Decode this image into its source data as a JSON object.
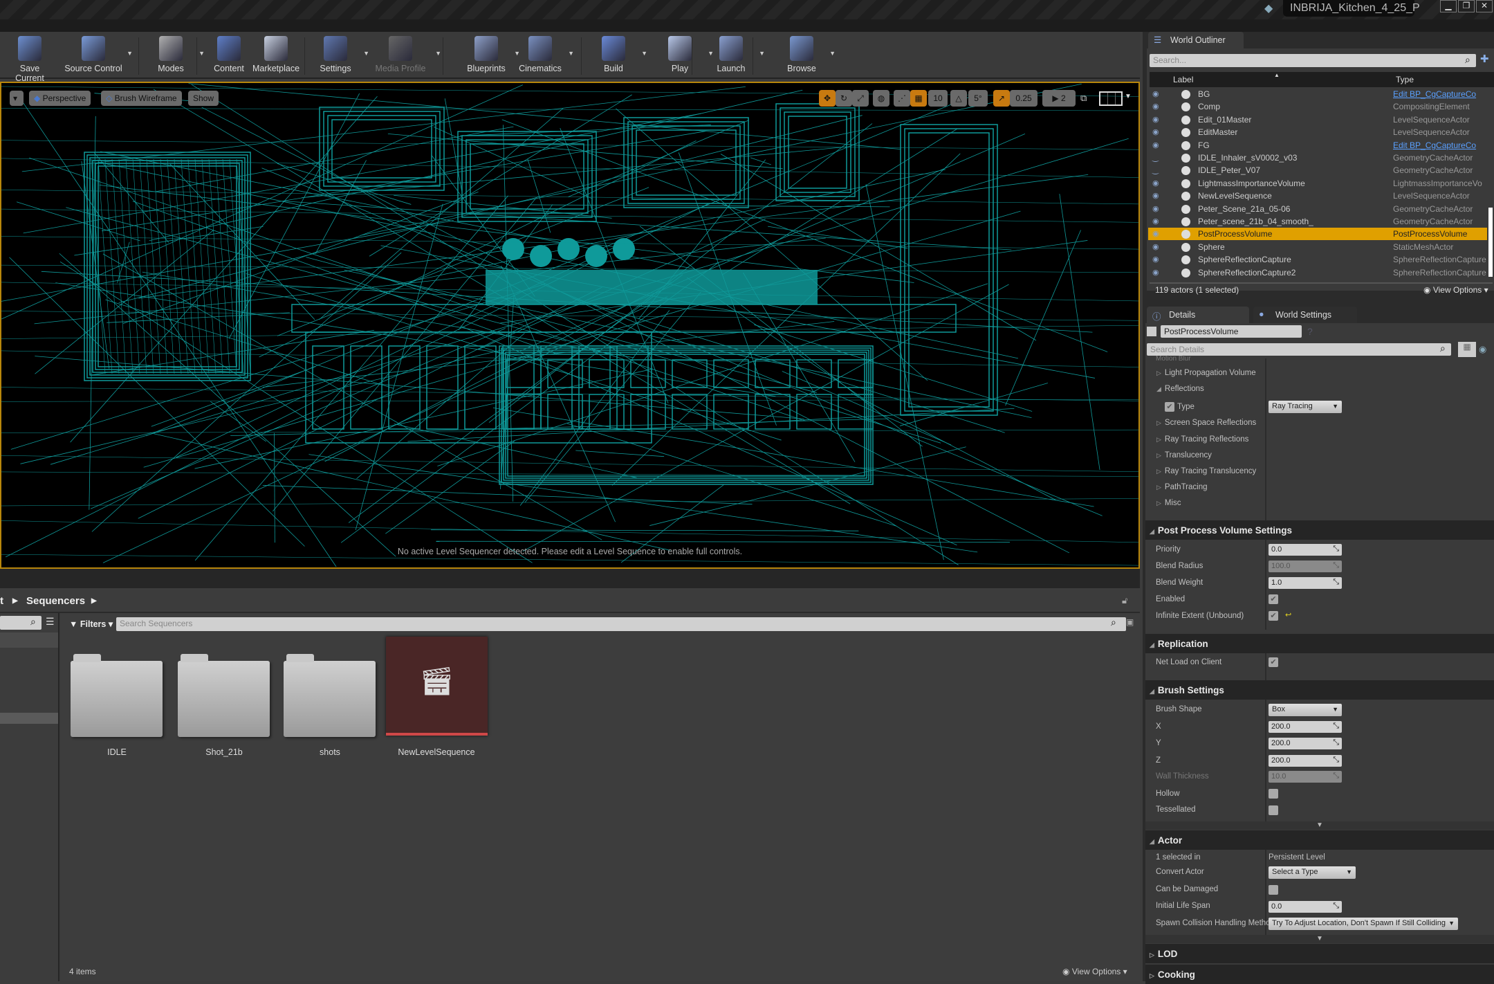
{
  "window": {
    "tab_title": "INBRIJA_Kitchen_4_25_P",
    "minimize": "▁",
    "maximize": "❐",
    "close": "✕"
  },
  "toolbar": {
    "items": [
      {
        "label": "Save Current",
        "icon": "save-icon",
        "color": "#6d8fd0"
      },
      {
        "label": "Source Control",
        "icon": "source-control-icon",
        "color": "#7a9bd8"
      },
      {
        "label": "Modes",
        "icon": "modes-icon",
        "color": "#b0b0b0"
      },
      {
        "label": "Content",
        "icon": "content-icon",
        "color": "#5f7fc8"
      },
      {
        "label": "Marketplace",
        "icon": "marketplace-icon",
        "color": "#c8d0e0"
      },
      {
        "label": "Settings",
        "icon": "settings-icon",
        "color": "#6078b0"
      },
      {
        "label": "Media Profile",
        "icon": "media-profile-icon",
        "color": "#666",
        "disabled": true
      },
      {
        "label": "Blueprints",
        "icon": "blueprints-icon",
        "color": "#8ea0c8"
      },
      {
        "label": "Cinematics",
        "icon": "cinematics-icon",
        "color": "#7a90c0"
      },
      {
        "label": "Build",
        "icon": "build-icon",
        "color": "#6a8ad8"
      },
      {
        "label": "Play",
        "icon": "play-icon",
        "color": "#b8c8e8"
      },
      {
        "label": "Launch",
        "icon": "launch-icon",
        "color": "#8aa0d0"
      },
      {
        "label": "Browse",
        "icon": "browse-icon",
        "color": "#7a98d0"
      }
    ]
  },
  "viewport": {
    "view_mode_button": "Perspective",
    "render_mode_button": "Brush Wireframe",
    "show_button": "Show",
    "grid_snap": "10",
    "rotation_snap": "5°",
    "scale_snap": "0.25",
    "camera_speed": "2",
    "message": "No active Level Sequencer detected. Please edit a Level Sequence to enable full controls.",
    "wire_color": "#0f9a9a"
  },
  "content_browser": {
    "breadcrumb": [
      "t",
      "Sequencers"
    ],
    "filters_label": "Filters",
    "search_placeholder": "Search Sequencers",
    "items": [
      {
        "name": "IDLE",
        "kind": "folder"
      },
      {
        "name": "Shot_21b",
        "kind": "folder"
      },
      {
        "name": "shots",
        "kind": "folder"
      },
      {
        "name": "NewLevelSequence",
        "kind": "level-sequence",
        "color": "#4a2626",
        "bar_color": "#d04848"
      }
    ],
    "item_count": "4 items",
    "view_options": "View Options"
  },
  "outliner": {
    "tab": "World Outliner",
    "search_placeholder": "Search...",
    "col_label": "Label",
    "col_type": "Type",
    "rows": [
      {
        "label": "BG",
        "type": "Edit BP_CgCaptureCo",
        "link": true,
        "visible": true
      },
      {
        "label": "Comp",
        "type": "CompositingElement",
        "visible": true
      },
      {
        "label": "Edit_01Master",
        "type": "LevelSequenceActor",
        "visible": true
      },
      {
        "label": "EditMaster",
        "type": "LevelSequenceActor",
        "visible": true
      },
      {
        "label": "FG",
        "type": "Edit BP_CgCaptureCo",
        "link": true,
        "visible": true
      },
      {
        "label": "IDLE_Inhaler_sV0002_v03",
        "type": "GeometryCacheActor",
        "visible": false
      },
      {
        "label": "IDLE_Peter_V07",
        "type": "GeometryCacheActor",
        "visible": false
      },
      {
        "label": "LightmassImportanceVolume",
        "type": "LightmassImportanceVo",
        "visible": true
      },
      {
        "label": "NewLevelSequence",
        "type": "LevelSequenceActor",
        "visible": true
      },
      {
        "label": "Peter_Scene_21a_05-06",
        "type": "GeometryCacheActor",
        "visible": true
      },
      {
        "label": "Peter_scene_21b_04_smooth_",
        "type": "GeometryCacheActor",
        "visible": true
      },
      {
        "label": "PostProcessVolume",
        "type": "PostProcessVolume",
        "visible": true,
        "selected": true
      },
      {
        "label": "Sphere",
        "type": "StaticMeshActor",
        "visible": true
      },
      {
        "label": "SphereReflectionCapture",
        "type": "SphereReflectionCapture",
        "visible": true
      },
      {
        "label": "SphereReflectionCapture2",
        "type": "SphereReflectionCapture",
        "visible": true
      }
    ],
    "status": "119 actors (1 selected)",
    "view_options": "View Options",
    "selection_color": "#e0a000"
  },
  "details": {
    "tab": "Details",
    "world_settings_tab": "World Settings",
    "actor_name": "PostProcessVolume",
    "search_placeholder": "Search Details",
    "cut_row": "Motion Blur",
    "categories": [
      "Light Propagation Volume",
      "Reflections",
      "Screen Space Reflections",
      "Ray Tracing Reflections",
      "Translucency",
      "Ray Tracing Translucency",
      "PathTracing",
      "Misc"
    ],
    "reflections_type_label": "Type",
    "reflections_type_value": "Ray Tracing",
    "ppv": {
      "title": "Post Process Volume Settings",
      "priority_label": "Priority",
      "priority": "0.0",
      "blend_radius_label": "Blend Radius",
      "blend_radius": "100.0",
      "blend_weight_label": "Blend Weight",
      "blend_weight": "1.0",
      "enabled_label": "Enabled",
      "enabled": true,
      "infinite_label": "Infinite Extent (Unbound)",
      "infinite": true
    },
    "replication": {
      "title": "Replication",
      "net_load_label": "Net Load on Client",
      "net_load": true
    },
    "brush": {
      "title": "Brush Settings",
      "shape_label": "Brush Shape",
      "shape": "Box",
      "x_label": "X",
      "x": "200.0",
      "y_label": "Y",
      "y": "200.0",
      "z_label": "Z",
      "z": "200.0",
      "wall_label": "Wall Thickness",
      "wall": "10.0",
      "hollow_label": "Hollow",
      "hollow": false,
      "tess_label": "Tessellated",
      "tess": false
    },
    "actor": {
      "title": "Actor",
      "selected_in_label": "1 selected in",
      "selected_in": "Persistent Level",
      "convert_label": "Convert Actor",
      "convert": "Select a Type",
      "damage_label": "Can be Damaged",
      "damage": false,
      "life_label": "Initial Life Span",
      "life": "0.0",
      "spawn_label": "Spawn Collision Handling Metho",
      "spawn": "Try To Adjust Location, Don't Spawn If Still Colliding"
    },
    "lod": "LOD",
    "cooking": "Cooking"
  }
}
